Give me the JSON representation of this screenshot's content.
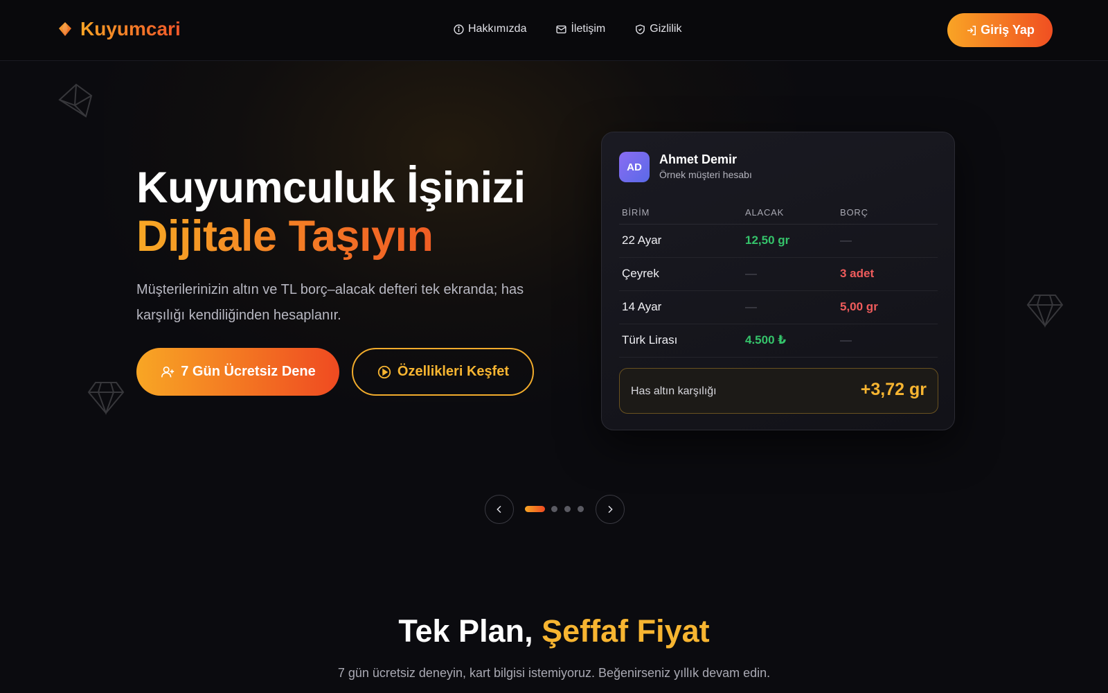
{
  "brand": {
    "name": "Kuyumcari"
  },
  "nav": {
    "items": [
      {
        "label": "Hakkımızda",
        "icon": "info-icon"
      },
      {
        "label": "İletişim",
        "icon": "mail-icon"
      },
      {
        "label": "Gizlilik",
        "icon": "shield-icon"
      }
    ],
    "login_label": "Giriş Yap"
  },
  "hero": {
    "title_line1": "Kuyumculuk İşinizi",
    "title_line2": "Dijitale Taşıyın",
    "description": "Müşterilerinizin altın ve TL borç–alacak defteri tek ekranda; has karşılığı kendiliğinden hesaplanır.",
    "primary_cta": "7 Gün Ücretsiz Dene",
    "secondary_cta": "Özellikleri Keşfet"
  },
  "card": {
    "avatar_initials": "AD",
    "customer_name": "Ahmet Demir",
    "customer_sub": "Örnek müşteri hesabı",
    "columns": [
      "BİRİM",
      "ALACAK",
      "BORÇ"
    ],
    "rows": [
      {
        "unit": "22 Ayar",
        "alacak": "12,50 gr",
        "borc": "—"
      },
      {
        "unit": "Çeyrek",
        "alacak": "—",
        "borc": "3 adet"
      },
      {
        "unit": "14 Ayar",
        "alacak": "—",
        "borc": "5,00 gr"
      },
      {
        "unit": "Türk Lirası",
        "alacak": "4.500 ₺",
        "borc": "—"
      }
    ],
    "summary_label": "Has altın karşılığı",
    "summary_value": "+3,72 gr"
  },
  "slider": {
    "slide_count": 4,
    "active_index": 0
  },
  "pricing": {
    "title_part1": "Tek Plan, ",
    "title_part2": "Şeffaf Fiyat",
    "subtitle": "7 gün ücretsiz deneyin, kart bilgisi istemiyoruz. Beğenirseniz yıllık devam edin."
  },
  "colors": {
    "accent_orange": "#f7a325",
    "accent_red": "#f0562a",
    "positive": "#35c46b",
    "negative": "#f05c5c",
    "gold": "#f7b531",
    "background": "#0b0b0f"
  }
}
